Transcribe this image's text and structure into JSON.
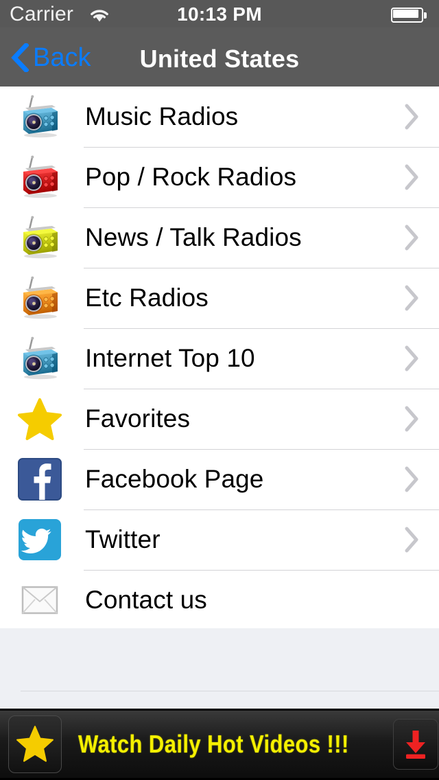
{
  "status_bar": {
    "carrier": "Carrier",
    "wifi_icon": "wifi-icon",
    "time": "10:13 PM",
    "battery_icon": "battery-full-icon"
  },
  "nav_bar": {
    "back_label": "Back",
    "back_icon": "chevron-left-icon",
    "title": "United States",
    "tint_color": "#0a7cff",
    "background_color": "#5b5b5b"
  },
  "list": {
    "items": [
      {
        "label": "Music Radios",
        "icon": "radio-icon-teal",
        "icon_color": "#4a9cc0",
        "chevron": true
      },
      {
        "label": "Pop / Rock Radios",
        "icon": "radio-icon-red",
        "icon_color": "#d41f1f",
        "chevron": true
      },
      {
        "label": "News / Talk Radios",
        "icon": "radio-icon-yellow",
        "icon_color": "#ccd117",
        "chevron": true
      },
      {
        "label": "Etc Radios",
        "icon": "radio-icon-orange",
        "icon_color": "#f09020",
        "chevron": true
      },
      {
        "label": "Internet Top 10",
        "icon": "radio-icon-teal",
        "icon_color": "#4a9cc0",
        "chevron": true
      },
      {
        "label": "Favorites",
        "icon": "star-icon",
        "icon_color": "#f5cc00",
        "chevron": true
      },
      {
        "label": "Facebook Page",
        "icon": "facebook-icon",
        "icon_color": "#3b5998",
        "chevron": true
      },
      {
        "label": "Twitter",
        "icon": "twitter-icon",
        "icon_color": "#29a3d8",
        "chevron": true
      },
      {
        "label": "Contact us",
        "icon": "envelope-icon",
        "icon_color": "#f4f4f4",
        "chevron": false
      }
    ]
  },
  "ad_banner": {
    "text": "Watch Daily Hot Videos !!!",
    "star_icon": "star-icon",
    "download_icon": "download-arrow-icon",
    "text_color": "#f5f000",
    "download_color": "#ee2222"
  }
}
